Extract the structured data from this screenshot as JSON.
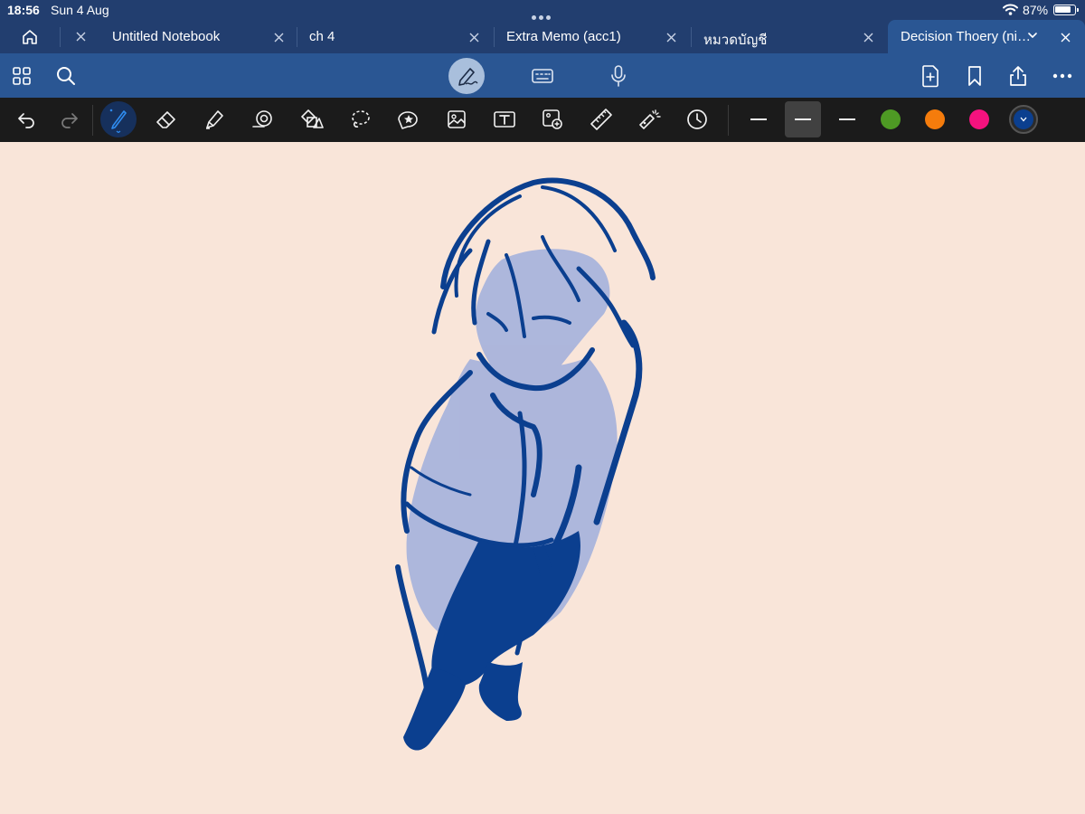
{
  "status_bar": {
    "time": "18:56",
    "date": "Sun 4 Aug",
    "battery_percent": "87%",
    "wifi_icon": "wifi-icon",
    "battery_icon": "battery-icon"
  },
  "tabs": [
    {
      "label": "Untitled Notebook"
    },
    {
      "label": "ch 4"
    },
    {
      "label": "Extra Memo (acc1)"
    },
    {
      "label": "หมวดบัญชี"
    },
    {
      "label": "Decision Thoery (ni…",
      "active": true
    }
  ],
  "nav_icons": [
    "thumbnails-icon",
    "search-icon",
    "pen-mode-icon",
    "keyboard-icon",
    "microphone-icon",
    "add-page-icon",
    "bookmark-icon",
    "share-icon",
    "more-icon"
  ],
  "tool_icons": [
    "undo-icon",
    "redo-icon",
    "pen-icon",
    "eraser-icon",
    "highlighter-icon",
    "tape-icon",
    "shapes-icon",
    "lasso-icon",
    "elements-icon",
    "image-icon",
    "text-icon",
    "camera-image-icon",
    "ruler-icon",
    "laser-pointer-icon",
    "history-icon"
  ],
  "colors": {
    "status_bg": "#223e6f",
    "nav_bg": "#2a5693",
    "toolbar_bg": "#1b1b1b",
    "canvas_bg": "#f9e5d9",
    "ink": "#0b3f8f",
    "ink_light": "#a9b4dc",
    "swatch_green": "#4e9a24",
    "swatch_orange": "#f57c0c",
    "swatch_pink": "#f5127e",
    "swatch_active": "#0b3f8f"
  }
}
